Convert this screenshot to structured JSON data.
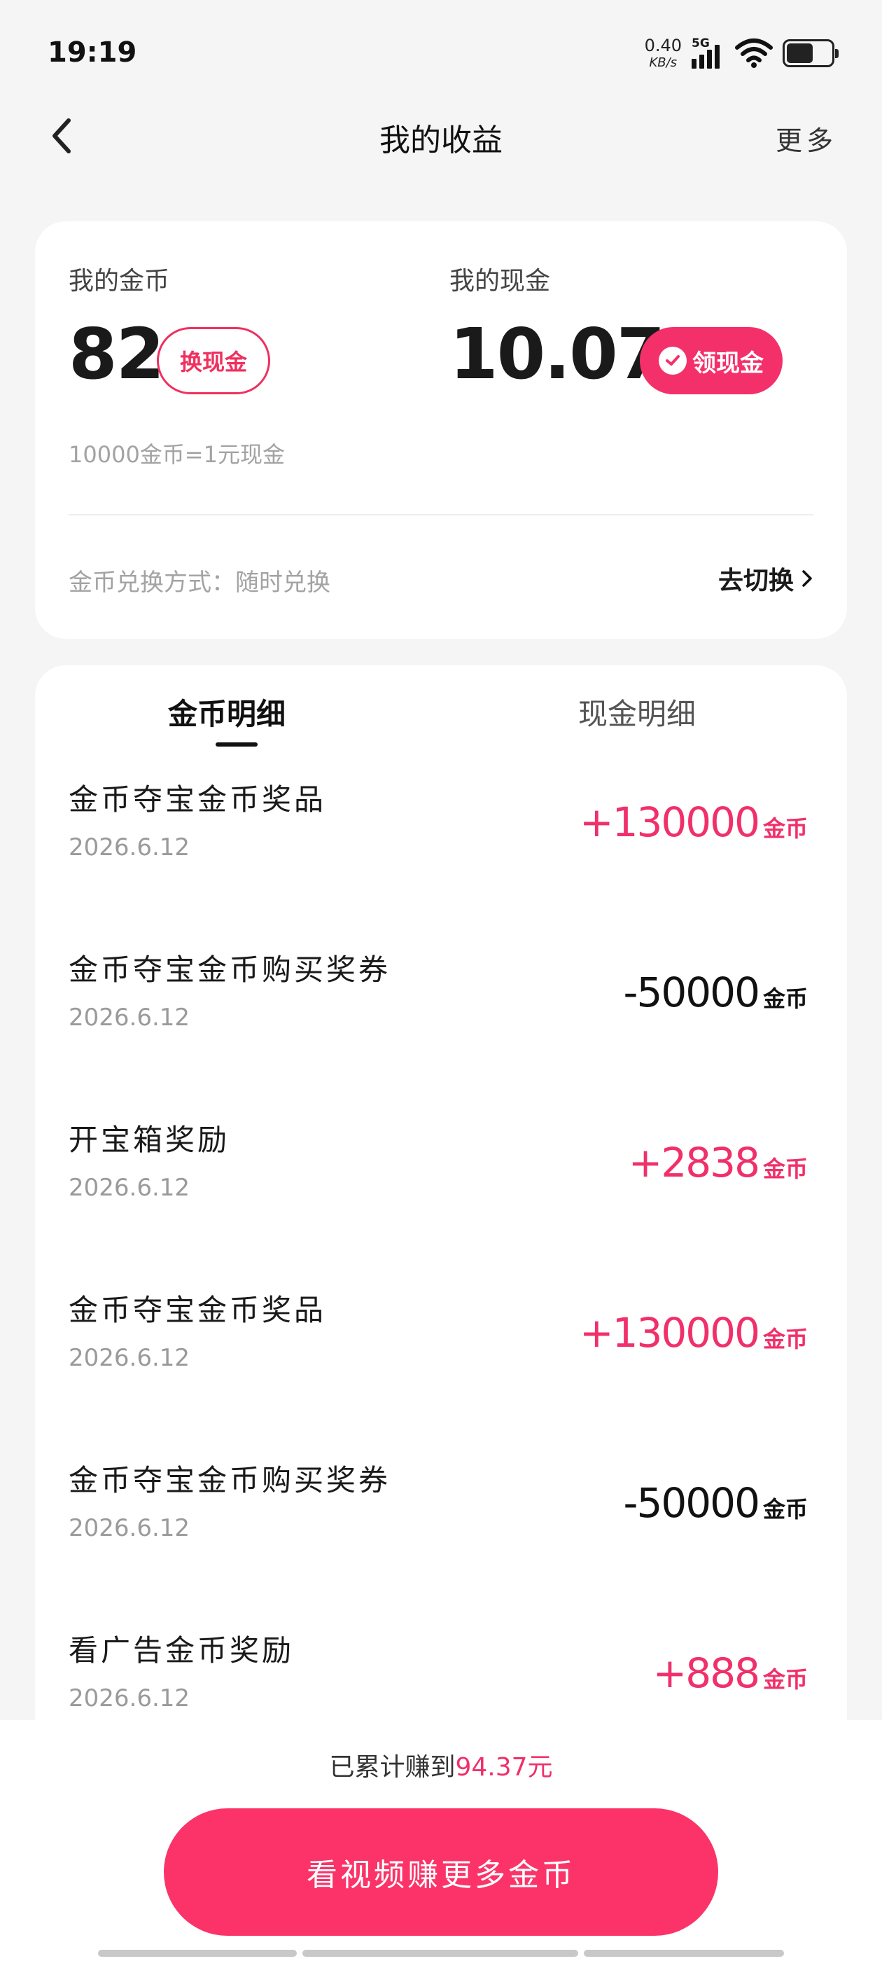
{
  "status_bar": {
    "time": "19:19",
    "net_speed_value": "0.40",
    "net_speed_unit": "KB/s",
    "network_type": "5G",
    "battery_level": 0.6
  },
  "nav": {
    "title": "我的收益",
    "more_label": "更多"
  },
  "summary": {
    "coins_label": "我的金币",
    "coins_value": "82",
    "exchange_button": "换现金",
    "cash_label": "我的现金",
    "cash_value": "10.07",
    "withdraw_button": "领现金",
    "rate_text": "10000金币=1元现金",
    "method_text": "金币兑换方式：随时兑换",
    "switch_label": "去切换"
  },
  "tabs": {
    "coin_detail": "金币明细",
    "cash_detail": "现金明细",
    "active": "coin_detail"
  },
  "transactions": [
    {
      "title": "金币夺宝金币奖品",
      "date": "2026.6.12",
      "amount": "+130000",
      "unit": "金币",
      "sign": "pos"
    },
    {
      "title": "金币夺宝金币购买奖券",
      "date": "2026.6.12",
      "amount": "-50000",
      "unit": "金币",
      "sign": "neg"
    },
    {
      "title": "开宝箱奖励",
      "date": "2026.6.12",
      "amount": "+2838",
      "unit": "金币",
      "sign": "pos"
    },
    {
      "title": "金币夺宝金币奖品",
      "date": "2026.6.12",
      "amount": "+130000",
      "unit": "金币",
      "sign": "pos"
    },
    {
      "title": "金币夺宝金币购买奖券",
      "date": "2026.6.12",
      "amount": "-50000",
      "unit": "金币",
      "sign": "neg"
    },
    {
      "title": "看广告金币奖励",
      "date": "2026.6.12",
      "amount": "+888",
      "unit": "金币",
      "sign": "pos"
    }
  ],
  "footer": {
    "earned_prefix": "已累计赚到",
    "earned_amount": "94.37元",
    "cta_label": "看视频赚更多金币"
  },
  "colors": {
    "accent": "#f0306a",
    "cta": "#fb3368",
    "background": "#f5f5f5"
  }
}
